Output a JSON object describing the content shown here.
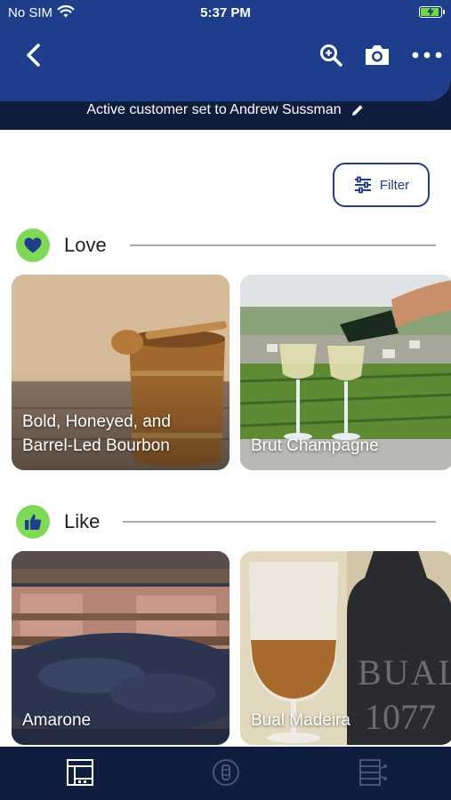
{
  "status_bar": {
    "carrier": "No SIM",
    "time": "5:37 PM",
    "battery_level": 0.85
  },
  "header": {
    "active_customer_text": "Active customer set to Andrew Sussman"
  },
  "filter": {
    "label": "Filter"
  },
  "sections": [
    {
      "title": "Love",
      "icon": "heart-icon",
      "cards": [
        {
          "label": "Bold, Honeyed, and Barrel-Led Bourbon"
        },
        {
          "label": "Brut Champagne"
        }
      ]
    },
    {
      "title": "Like",
      "icon": "thumbs-up-icon",
      "cards": [
        {
          "label": "Amarone"
        },
        {
          "label": "Bual Madeira"
        }
      ]
    }
  ],
  "tabbar": {
    "tabs": [
      "catalog-icon",
      "barrel-icon",
      "hierarchy-icon"
    ]
  },
  "colors": {
    "header_blue": "#1e3e8c",
    "header_navy": "#0f1d3f",
    "badge_green": "#7fd957"
  }
}
